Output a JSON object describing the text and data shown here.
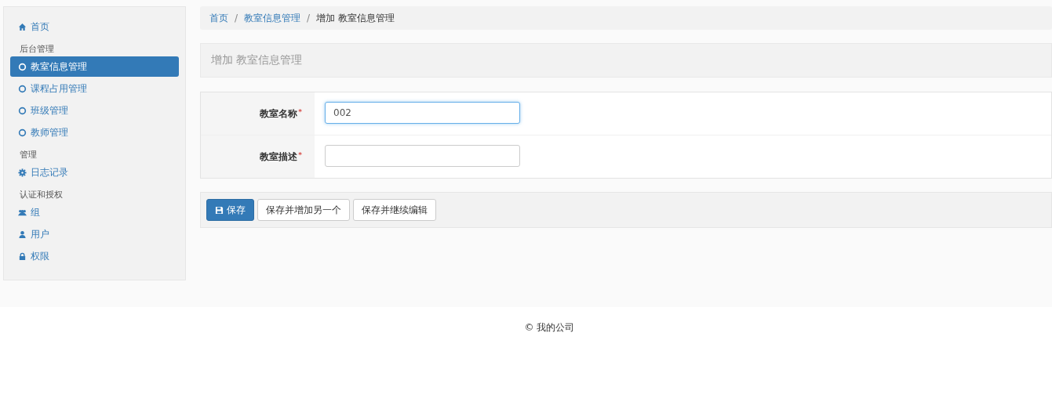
{
  "sidebar": {
    "items": [
      {
        "kind": "link",
        "label": "首页",
        "selected": false
      },
      {
        "kind": "header",
        "label": "后台管理"
      },
      {
        "kind": "link",
        "label": "教室信息管理",
        "selected": true
      },
      {
        "kind": "link",
        "label": "课程占用管理",
        "selected": false
      },
      {
        "kind": "link",
        "label": "班级管理",
        "selected": false
      },
      {
        "kind": "link",
        "label": "教师管理",
        "selected": false
      },
      {
        "kind": "header",
        "label": "管理"
      },
      {
        "kind": "link",
        "label": "日志记录",
        "selected": false
      },
      {
        "kind": "header",
        "label": "认证和授权"
      },
      {
        "kind": "link",
        "label": "组",
        "selected": false
      },
      {
        "kind": "link",
        "label": "用户",
        "selected": false
      },
      {
        "kind": "link",
        "label": "权限",
        "selected": false
      }
    ]
  },
  "breadcrumb": [
    {
      "label": "首页",
      "kind": "link"
    },
    {
      "separator": "/",
      "label": "教室信息管理",
      "kind": "link"
    },
    {
      "separator": "/",
      "label": "增加 教室信息管理",
      "kind": "current"
    }
  ],
  "panel_title": "增加 教室信息管理",
  "form": {
    "fields": [
      {
        "label": "教室名称",
        "required_mark": "*",
        "value": "002",
        "focused": true
      },
      {
        "label": "教室描述",
        "required_mark": "*",
        "focused": false
      }
    ]
  },
  "buttons": [
    {
      "label": "保存",
      "kind": "primary"
    },
    {
      "label": "保存并增加另一个",
      "kind": "default"
    },
    {
      "label": "保存并继续编辑",
      "kind": "default"
    }
  ],
  "footer": "© 我的公司"
}
